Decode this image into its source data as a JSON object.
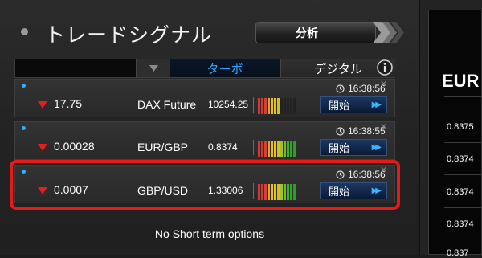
{
  "panel": {
    "title": "トレードシグナル",
    "analyze_label": "分析"
  },
  "tabs": {
    "turbo": "ターボ",
    "digital": "デジタル",
    "info_icon": "info-icon"
  },
  "signals": [
    {
      "change": "17.75",
      "asset": "DAX Future",
      "price": "10254.25",
      "time": "16:38:56",
      "start_label": "開始",
      "strength_bars": [
        "#d33",
        "#d33",
        "#c43",
        "#e8a020",
        "#e8c020",
        "#e8c020",
        "#d0c020",
        "#222",
        "#222",
        "#222",
        "#222",
        "#222"
      ]
    },
    {
      "change": "0.00028",
      "asset": "EUR/GBP",
      "price": "0.8374",
      "time": "16:38:55",
      "start_label": "開始",
      "strength_bars": [
        "#d33",
        "#d33",
        "#c43",
        "#e8a020",
        "#e8c020",
        "#e8c020",
        "#d0c020",
        "#a8c020",
        "#6cbf2a",
        "#3fb02a",
        "#2fa82a",
        "#2a9e2a"
      ]
    },
    {
      "change": "0.0007",
      "asset": "GBP/USD",
      "price": "1.33006",
      "time": "16:38:56",
      "start_label": "開始",
      "strength_bars": [
        "#d33",
        "#d33",
        "#c43",
        "#e8a020",
        "#e8c020",
        "#e8c020",
        "#d0c020",
        "#a8c020",
        "#6cbf2a",
        "#3fb02a",
        "#2fa82a",
        "#2a9e2a"
      ]
    }
  ],
  "no_short_term": "No Short term options",
  "right_panel": {
    "pair_title": "EUR",
    "quotes": [
      "0.8375",
      "0.8374",
      "0.8374",
      "0.8374",
      "0.837"
    ]
  },
  "colors": {
    "accent": "#2aa4ff",
    "highlight": "#e81919",
    "down_arrow": "#e02020"
  }
}
